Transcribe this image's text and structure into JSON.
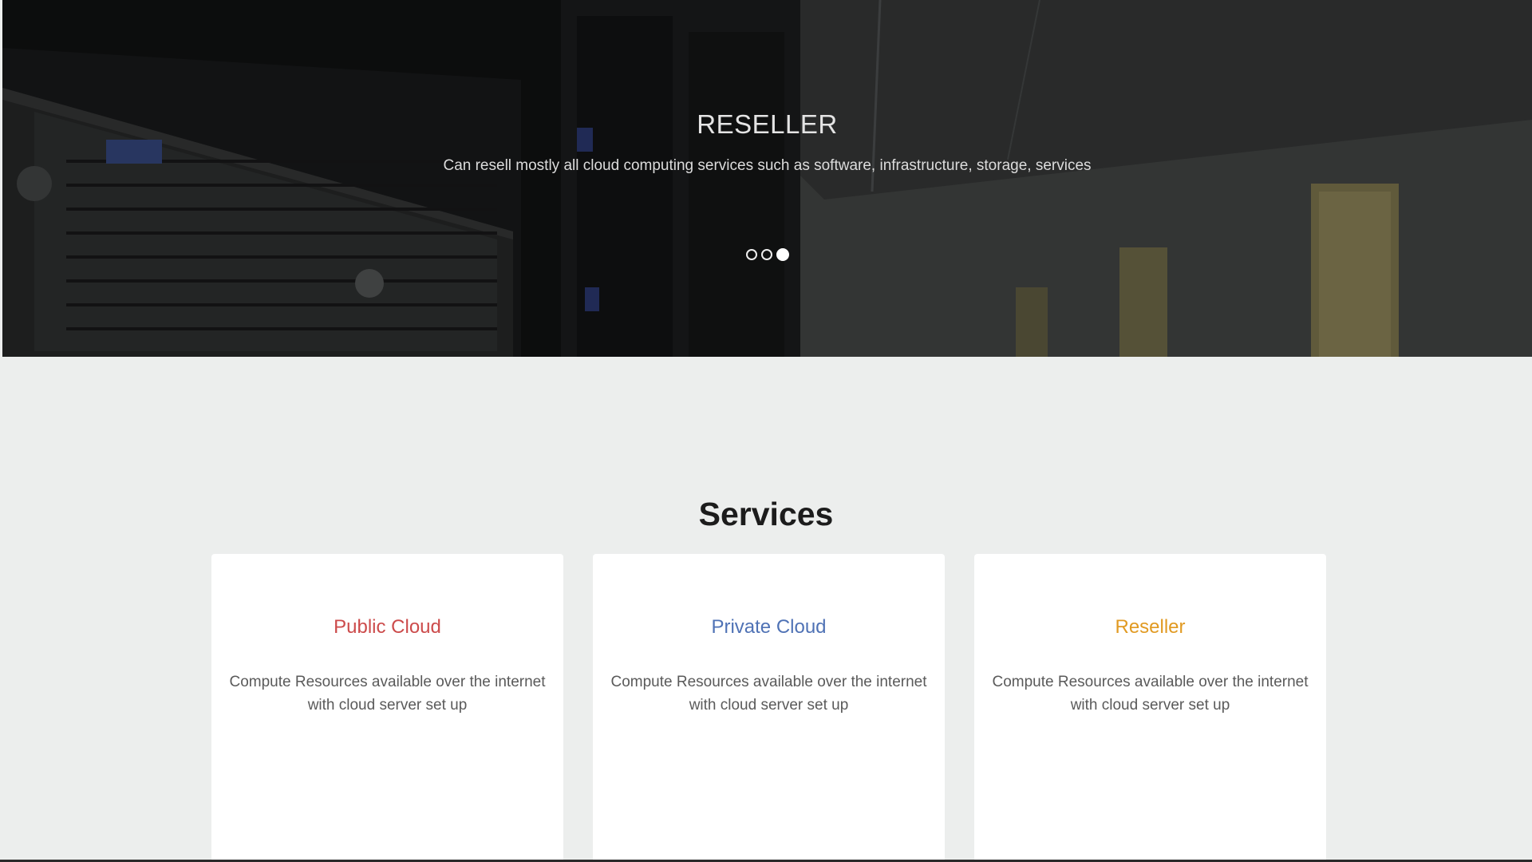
{
  "hero": {
    "title": "RESELLER",
    "subtitle": "Can resell mostly all cloud computing services such as software, infrastructure, storage, services",
    "slide_count": 3,
    "active_slide": 3
  },
  "services": {
    "heading": "Services",
    "cards": [
      {
        "title": "Public Cloud",
        "title_color": "#cc4b4b",
        "description": "Compute Resources available over the internet with cloud server set up"
      },
      {
        "title": "Private Cloud",
        "title_color": "#4f72b5",
        "description": "Compute Resources available over the internet with cloud server set up"
      },
      {
        "title": "Reseller",
        "title_color": "#e19a22",
        "description": "Compute Resources available over the internet with cloud server set up"
      }
    ]
  }
}
